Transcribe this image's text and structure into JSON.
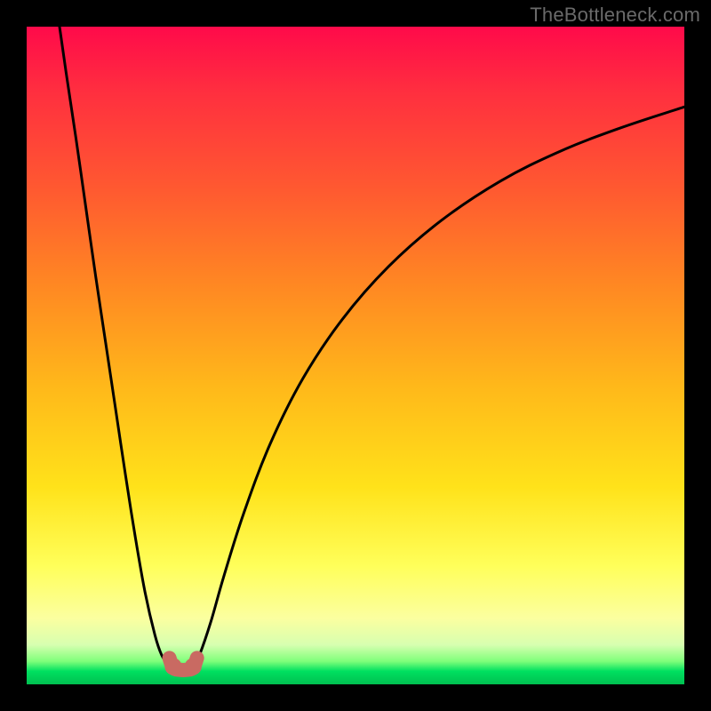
{
  "watermark": {
    "text": "TheBottleneck.com"
  },
  "chart_data": {
    "type": "line",
    "title": "",
    "xlabel": "",
    "ylabel": "",
    "xlim": [
      0,
      1
    ],
    "ylim": [
      0,
      1
    ],
    "series": [
      {
        "name": "left-branch",
        "x": [
          0.05,
          0.06,
          0.075,
          0.09,
          0.105,
          0.12,
          0.135,
          0.15,
          0.165,
          0.18,
          0.195,
          0.205,
          0.215,
          0.223
        ],
        "y": [
          1.0,
          0.93,
          0.83,
          0.725,
          0.62,
          0.52,
          0.42,
          0.32,
          0.225,
          0.14,
          0.075,
          0.045,
          0.03,
          0.025
        ]
      },
      {
        "name": "valley-floor",
        "x": [
          0.223,
          0.233,
          0.243,
          0.253
        ],
        "y": [
          0.025,
          0.022,
          0.022,
          0.025
        ]
      },
      {
        "name": "right-branch",
        "x": [
          0.253,
          0.263,
          0.28,
          0.3,
          0.33,
          0.37,
          0.42,
          0.48,
          0.55,
          0.63,
          0.72,
          0.81,
          0.9,
          1.0
        ],
        "y": [
          0.025,
          0.045,
          0.095,
          0.165,
          0.26,
          0.365,
          0.465,
          0.555,
          0.635,
          0.705,
          0.765,
          0.81,
          0.845,
          0.878
        ]
      }
    ],
    "markers": [
      {
        "x": 0.223,
        "y": 0.027,
        "r": 0.013
      },
      {
        "x": 0.253,
        "y": 0.027,
        "r": 0.013
      }
    ],
    "colors": {
      "curve": "#000000",
      "marker": "#c96a62",
      "gradient_top": "#ff0a4a",
      "gradient_bottom": "#00c050"
    }
  }
}
